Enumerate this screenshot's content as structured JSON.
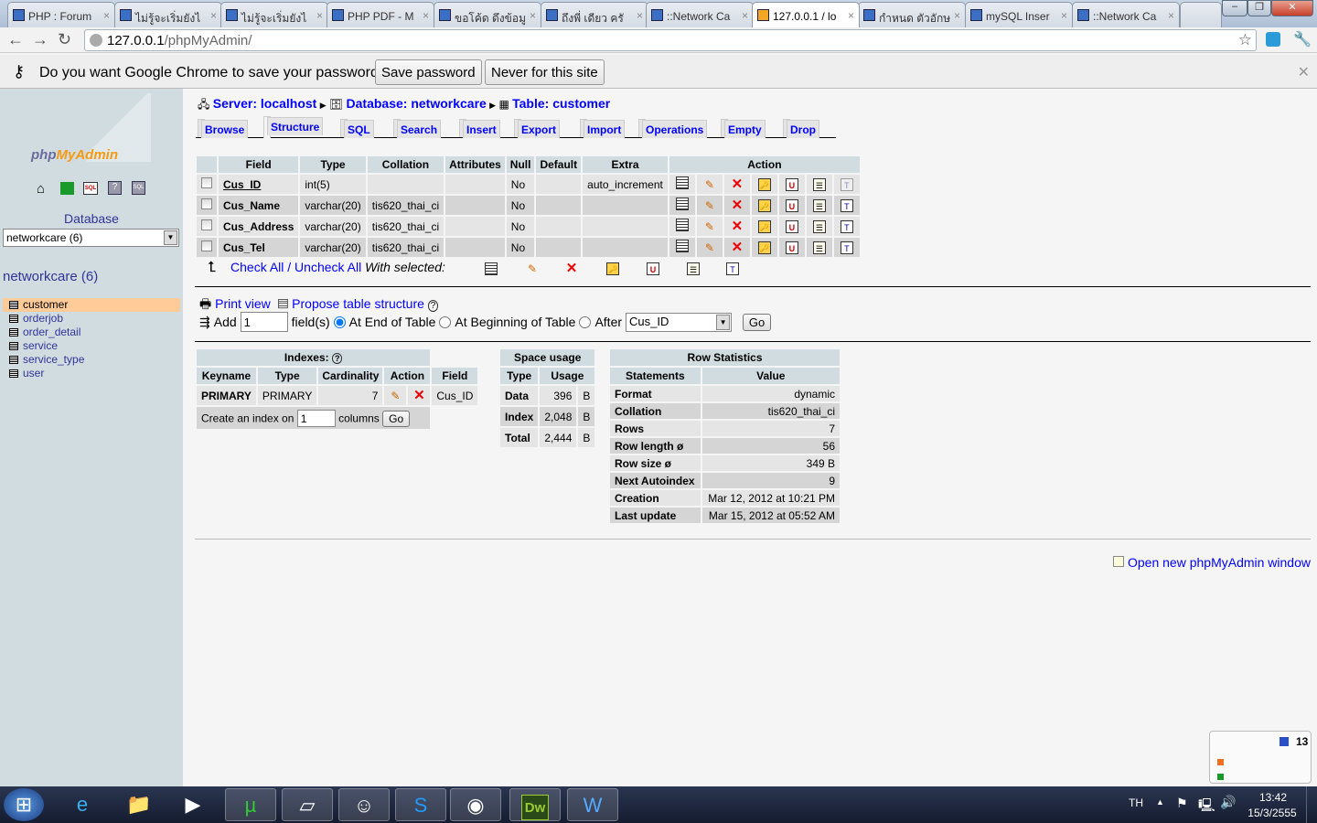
{
  "browser": {
    "tabs": [
      {
        "title": "PHP : Forum"
      },
      {
        "title": "ไม่รู้จะเริ่มยังไ"
      },
      {
        "title": "ไม่รู้จะเริ่มยังไ"
      },
      {
        "title": "PHP PDF - M"
      },
      {
        "title": "ขอโค้ด ดึงข้อมู"
      },
      {
        "title": "ถึงพี่ เดียว ครั"
      },
      {
        "title": "::Network Ca"
      },
      {
        "title": "127.0.0.1 / lo"
      },
      {
        "title": "กำหนด ตัวอักษ"
      },
      {
        "title": "mySQL Inser"
      },
      {
        "title": "::Network Ca"
      }
    ],
    "url_host": "127.0.0.1",
    "url_path": "/phpMyAdmin/",
    "password_prompt": "Do you want Google Chrome to save your password?",
    "save_password": "Save password",
    "never_for_site": "Never for this site"
  },
  "sidebar": {
    "logo": "phpMyAdmin",
    "database_label": "Database",
    "database_select": "networkcare (6)",
    "db_heading": "networkcare (6)",
    "tables": [
      "customer",
      "orderjob",
      "order_detail",
      "service",
      "service_type",
      "user"
    ],
    "selected": "customer"
  },
  "breadcrumb": {
    "server": "Server: localhost",
    "database": "Database: networkcare",
    "table": "Table: customer"
  },
  "tabs": [
    "Browse",
    "Structure",
    "SQL",
    "Search",
    "Insert",
    "Export",
    "Import",
    "Operations",
    "Empty",
    "Drop"
  ],
  "structure": {
    "headers": [
      "Field",
      "Type",
      "Collation",
      "Attributes",
      "Null",
      "Default",
      "Extra",
      "Action"
    ],
    "rows": [
      {
        "field": "Cus_ID",
        "type": "int(5)",
        "collation": "",
        "attributes": "",
        "null": "No",
        "default": "",
        "extra": "auto_increment"
      },
      {
        "field": "Cus_Name",
        "type": "varchar(20)",
        "collation": "tis620_thai_ci",
        "attributes": "",
        "null": "No",
        "default": "",
        "extra": ""
      },
      {
        "field": "Cus_Address",
        "type": "varchar(20)",
        "collation": "tis620_thai_ci",
        "attributes": "",
        "null": "No",
        "default": "",
        "extra": ""
      },
      {
        "field": "Cus_Tel",
        "type": "varchar(20)",
        "collation": "tis620_thai_ci",
        "attributes": "",
        "null": "No",
        "default": "",
        "extra": ""
      }
    ],
    "check_all": "Check All",
    "uncheck_all": "Uncheck All",
    "with_selected": "With selected:"
  },
  "links": {
    "print_view": "Print view",
    "propose": "Propose table structure"
  },
  "add_fields": {
    "label": "Add",
    "value": "1",
    "fields": "field(s)",
    "end": "At End of Table",
    "beginning": "At Beginning of Table",
    "after": "After",
    "after_field": "Cus_ID",
    "go": "Go"
  },
  "indexes": {
    "title": "Indexes:",
    "headers": [
      "Keyname",
      "Type",
      "Cardinality",
      "Action",
      "Field"
    ],
    "rows": [
      {
        "keyname": "PRIMARY",
        "type": "PRIMARY",
        "cardinality": "7",
        "field": "Cus_ID"
      }
    ],
    "create_label": "Create an index on",
    "create_value": "1",
    "columns": "columns",
    "go": "Go"
  },
  "space": {
    "title": "Space usage",
    "headers": [
      "Type",
      "Usage"
    ],
    "rows": [
      {
        "type": "Data",
        "usage": "396",
        "unit": "B"
      },
      {
        "type": "Index",
        "usage": "2,048",
        "unit": "B"
      },
      {
        "type": "Total",
        "usage": "2,444",
        "unit": "B"
      }
    ]
  },
  "rowstats": {
    "title": "Row Statistics",
    "headers": [
      "Statements",
      "Value"
    ],
    "rows": [
      {
        "k": "Format",
        "v": "dynamic"
      },
      {
        "k": "Collation",
        "v": "tis620_thai_ci"
      },
      {
        "k": "Rows",
        "v": "7"
      },
      {
        "k": "Row length ø",
        "v": "56"
      },
      {
        "k": "Row size ø",
        "v": "349 B"
      },
      {
        "k": "Next Autoindex",
        "v": "9"
      },
      {
        "k": "Creation",
        "v": "Mar 12, 2012 at 10:21 PM"
      },
      {
        "k": "Last update",
        "v": "Mar 15, 2012 at 05:52 AM"
      }
    ]
  },
  "open_window": "Open new phpMyAdmin window",
  "widget": {
    "count": "13"
  },
  "taskbar": {
    "lang": "TH",
    "time": "13:42",
    "date": "15/3/2555",
    "dw": "Dw"
  }
}
